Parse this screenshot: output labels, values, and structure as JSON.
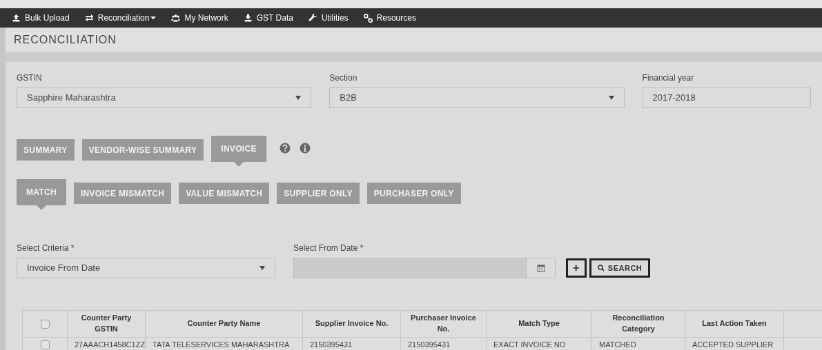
{
  "navbar": {
    "items": [
      {
        "label": "Bulk Upload",
        "dropdown": false
      },
      {
        "label": "Reconciliation",
        "dropdown": true
      },
      {
        "label": "My Network",
        "dropdown": false
      },
      {
        "label": "GST Data",
        "dropdown": false
      },
      {
        "label": "Utilities",
        "dropdown": false
      },
      {
        "label": "Resources",
        "dropdown": false
      }
    ]
  },
  "page_title": "RECONCILIATION",
  "filters": [
    {
      "label": "GSTIN",
      "kind": "select",
      "value": "Sapphire Maharashtra"
    },
    {
      "label": "Section",
      "kind": "select",
      "value": "B2B"
    },
    {
      "label": "Financial year",
      "kind": "text",
      "value": "2017-2018"
    }
  ],
  "view_tabs": [
    {
      "label": "SUMMARY",
      "selected": false
    },
    {
      "label": "VENDOR-WISE SUMMARY",
      "selected": false
    },
    {
      "label": "INVOICE",
      "selected": true
    }
  ],
  "category_tabs": [
    {
      "label": "MATCH",
      "selected": true
    },
    {
      "label": "INVOICE MISMATCH",
      "selected": false
    },
    {
      "label": "VALUE MISMATCH",
      "selected": false
    },
    {
      "label": "SUPPLIER ONLY",
      "selected": false
    },
    {
      "label": "PURCHASER ONLY",
      "selected": false
    }
  ],
  "criteria": {
    "label": "Select Criteria *",
    "value": "Invoice From Date"
  },
  "from_date": {
    "label": "Select From Date *",
    "disabled": true
  },
  "search_button": "SEARCH",
  "add_button": "+",
  "table": {
    "header_checked": false,
    "columns": [
      "Counter Party GSTIN",
      "Counter Party Name",
      "Supplier Invoice No.",
      "Purchaser Invoice No.",
      "Match Type",
      "Reconciliation Category",
      "Last Action Taken"
    ],
    "rows": [
      {
        "checked": false,
        "cells": [
          "27AAACH1458C1ZZ",
          "TATA TELESERVICES MAHARASHTRA",
          "2150395431",
          "2150395431",
          "EXACT INVOICE NO",
          "MATCHED",
          "ACCEPTED SUPPLIER"
        ]
      }
    ]
  }
}
